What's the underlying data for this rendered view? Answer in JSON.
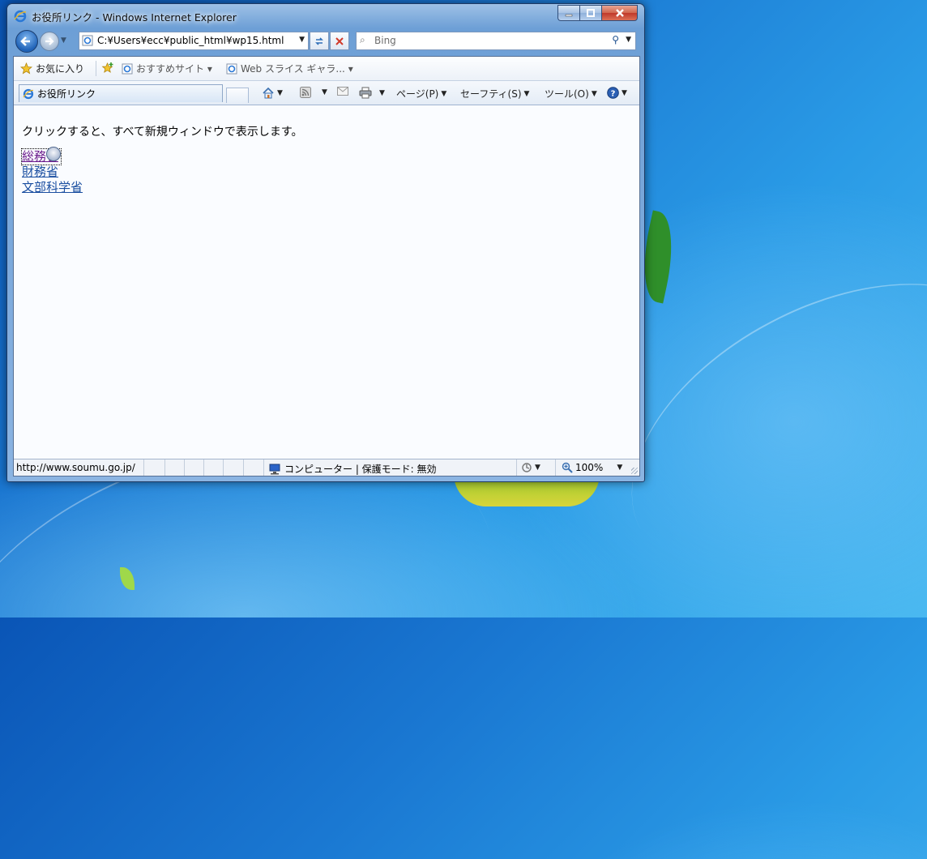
{
  "window": {
    "title": "お役所リンク - Windows Internet Explorer"
  },
  "address_bar": {
    "url": "C:¥Users¥ecc¥public_html¥wp15.html"
  },
  "search_box": {
    "placeholder": "Bing"
  },
  "favorites_bar": {
    "favorites_label": "お気に入り",
    "items": [
      {
        "label": "おすすめサイト ▾"
      },
      {
        "label": "Web スライス ギャラ... ▾"
      }
    ]
  },
  "tab": {
    "label": "お役所リンク"
  },
  "command_bar": {
    "page_label": "ページ(P)",
    "safety_label": "セーフティ(S)",
    "tools_label": "ツール(O)"
  },
  "page": {
    "intro_text": "クリックすると、すべて新規ウィンドウで表示します。",
    "links": [
      {
        "label": "総務省"
      },
      {
        "label": "財務省"
      },
      {
        "label": "文部科学省"
      }
    ]
  },
  "status_bar": {
    "url": "http://www.soumu.go.jp/",
    "zone_text": "コンピューター | 保護モード: 無効",
    "zoom": "100%"
  },
  "colors": {
    "link": "#1a4ea0",
    "visited_link": "#6b1a8c",
    "desktop_accent": "#1a78d2"
  },
  "icons": [
    "ie-logo-icon",
    "back-arrow-icon",
    "forward-arrow-icon",
    "refresh-icon",
    "stop-icon",
    "search-icon",
    "star-icon",
    "add-favorites-icon",
    "home-icon",
    "rss-icon",
    "mail-icon",
    "print-icon",
    "help-icon",
    "computer-icon",
    "zoom-icon"
  ]
}
